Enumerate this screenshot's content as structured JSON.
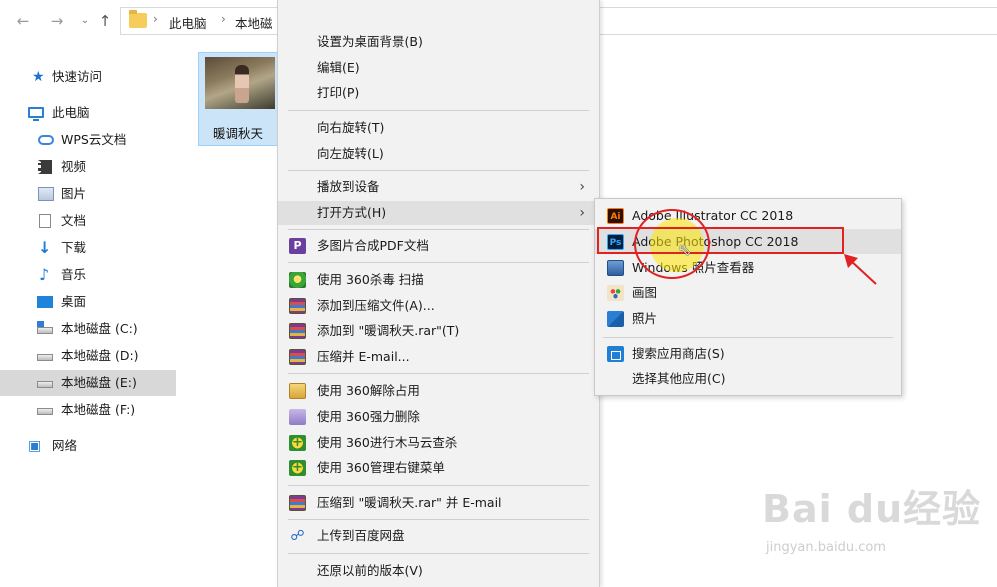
{
  "nav": {
    "back_icon": "arrow-left-icon",
    "forward_icon": "arrow-right-icon",
    "up_icon": "arrow-up-icon",
    "breadcrumbs": [
      "此电脑",
      "本地磁"
    ]
  },
  "sidebar": {
    "items": [
      {
        "label": "快速访问",
        "icon": "star-icon"
      },
      {
        "label": "此电脑",
        "icon": "computer-icon"
      },
      {
        "label": "WPS云文档",
        "icon": "cloud-icon"
      },
      {
        "label": "视频",
        "icon": "video-icon"
      },
      {
        "label": "图片",
        "icon": "pictures-icon"
      },
      {
        "label": "文档",
        "icon": "document-icon"
      },
      {
        "label": "下载",
        "icon": "download-icon"
      },
      {
        "label": "音乐",
        "icon": "music-icon"
      },
      {
        "label": "桌面",
        "icon": "desktop-icon"
      },
      {
        "label": "本地磁盘 (C:)",
        "icon": "drive-icon"
      },
      {
        "label": "本地磁盘 (D:)",
        "icon": "drive-icon"
      },
      {
        "label": "本地磁盘 (E:)",
        "icon": "drive-icon"
      },
      {
        "label": "本地磁盘 (F:)",
        "icon": "drive-icon"
      },
      {
        "label": "网络",
        "icon": "network-icon"
      }
    ],
    "selected": "本地磁盘 (E:)"
  },
  "file": {
    "name": "暖调秋天"
  },
  "context_menu": {
    "items": [
      "设置为桌面背景(B)",
      "编辑(E)",
      "打印(P)",
      "向右旋转(T)",
      "向左旋转(L)",
      "播放到设备",
      "打开方式(H)",
      "多图片合成PDF文档",
      "使用 360杀毒 扫描",
      "添加到压缩文件(A)...",
      "添加到 \"暖调秋天.rar\"(T)",
      "压缩并 E-mail...",
      "使用 360解除占用",
      "使用 360强力删除",
      "使用 360进行木马云查杀",
      "使用 360管理右键菜单",
      "压缩到 \"暖调秋天.rar\" 并 E-mail",
      "上传到百度网盘",
      "还原以前的版本(V)"
    ],
    "submenu_arrow": "›"
  },
  "open_with": {
    "items": [
      {
        "label": "Adobe Illustrator CC 2018",
        "icon_text": "Ai"
      },
      {
        "label": "Adobe Photoshop CC 2018",
        "icon_text": "Ps"
      },
      {
        "label": "Windows 照片查看器",
        "icon_text": ""
      },
      {
        "label": "画图",
        "icon_text": ""
      },
      {
        "label": "照片",
        "icon_text": ""
      },
      {
        "label": "搜索应用商店(S)",
        "icon_text": ""
      },
      {
        "label": "选择其他应用(C)",
        "icon_text": ""
      }
    ],
    "highlighted": "Adobe Photoshop CC 2018"
  },
  "watermark": {
    "logo": "Bai du经验",
    "url": "jingyan.baidu.com"
  },
  "colors": {
    "highlight_box": "#e02222",
    "accent": "#1e7ad8"
  }
}
